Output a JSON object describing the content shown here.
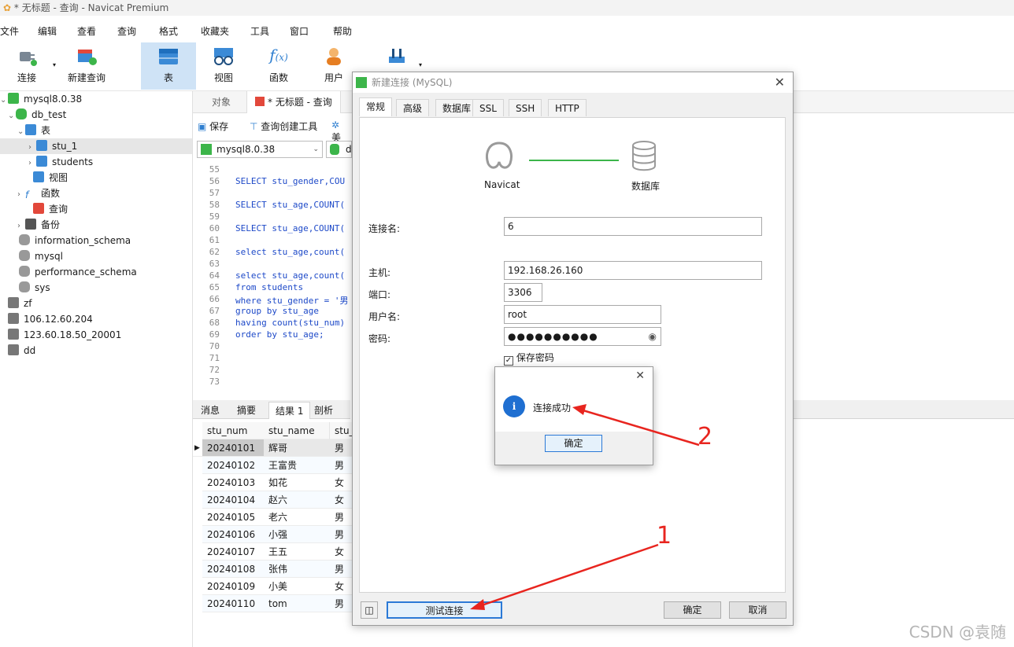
{
  "window": {
    "title": "* 无标题 - 查询 - Navicat Premium"
  },
  "menu": [
    "文件",
    "编辑",
    "查看",
    "查询",
    "格式",
    "收藏夹",
    "工具",
    "窗口",
    "帮助"
  ],
  "toolbar": {
    "items": [
      "连接",
      "新建查询",
      "表",
      "视图",
      "函数",
      "用户"
    ]
  },
  "sidebar": {
    "connection": "mysql8.0.38",
    "database": "db_test",
    "tables_group": "表",
    "tables": [
      "stu_1",
      "students"
    ],
    "views": "视图",
    "functions": "函数",
    "queries": "查询",
    "backups": "备份",
    "other_dbs": [
      "information_schema",
      "mysql",
      "performance_schema",
      "sys"
    ],
    "other_connections": [
      "zf",
      "106.12.60.204",
      "123.60.18.50_20001",
      "dd"
    ]
  },
  "tabs": {
    "objects": "对象",
    "query": "* 无标题 - 查询"
  },
  "sql_toolbar": {
    "save": "保存",
    "builder": "查询创建工具",
    "beautify": "美"
  },
  "connection_select": "mysql8.0.38",
  "db_select": "db",
  "editor": {
    "line_numbers": [
      "55",
      "56",
      "57",
      "58",
      "59",
      "60",
      "61",
      "62",
      "63",
      "64",
      "65",
      "66",
      "67",
      "68",
      "69",
      "70",
      "71",
      "72",
      "73"
    ],
    "lines": [
      "",
      "SELECT stu_gender,COU",
      "",
      "SELECT stu_age,COUNT(",
      "",
      "SELECT stu_age,COUNT(",
      "",
      "select stu_age,count(",
      "",
      "select stu_age,count(",
      "from students",
      "where stu_gender = '男",
      "group by stu_age",
      "having count(stu_num)",
      "order by stu_age;",
      "",
      "",
      "",
      ""
    ]
  },
  "result_tabs": [
    "消息",
    "摘要",
    "结果 1",
    "剖析"
  ],
  "result": {
    "columns": [
      "stu_num",
      "stu_name",
      "stu_"
    ],
    "rows": [
      [
        "20240101",
        "辉哥",
        "男"
      ],
      [
        "20240102",
        "王富贵",
        "男"
      ],
      [
        "20240103",
        "如花",
        "女"
      ],
      [
        "20240104",
        "赵六",
        "女"
      ],
      [
        "20240105",
        "老六",
        "男"
      ],
      [
        "20240106",
        "小强",
        "男"
      ],
      [
        "20240107",
        "王五",
        "女"
      ],
      [
        "20240108",
        "张伟",
        "男"
      ],
      [
        "20240109",
        "小美",
        "女"
      ],
      [
        "20240110",
        "tom",
        "男"
      ]
    ]
  },
  "dialog": {
    "title": "新建连接 (MySQL)",
    "tabs": [
      "常规",
      "高级",
      "数据库",
      "SSL",
      "SSH",
      "HTTP"
    ],
    "navicat_label": "Navicat",
    "db_label": "数据库",
    "fields": {
      "conn_name_label": "连接名:",
      "conn_name": "6",
      "host_label": "主机:",
      "host": "192.168.26.160",
      "port_label": "端口:",
      "port": "3306",
      "user_label": "用户名:",
      "user": "root",
      "pwd_label": "密码:",
      "pwd": "●●●●●●●●●●",
      "save_pwd": "保存密码"
    },
    "test_button": "测试连接",
    "ok_button": "确定",
    "cancel_button": "取消"
  },
  "message": {
    "text": "连接成功",
    "ok": "确定"
  },
  "annotations": {
    "one": "1",
    "two": "2"
  },
  "watermark": "CSDN @袁随"
}
